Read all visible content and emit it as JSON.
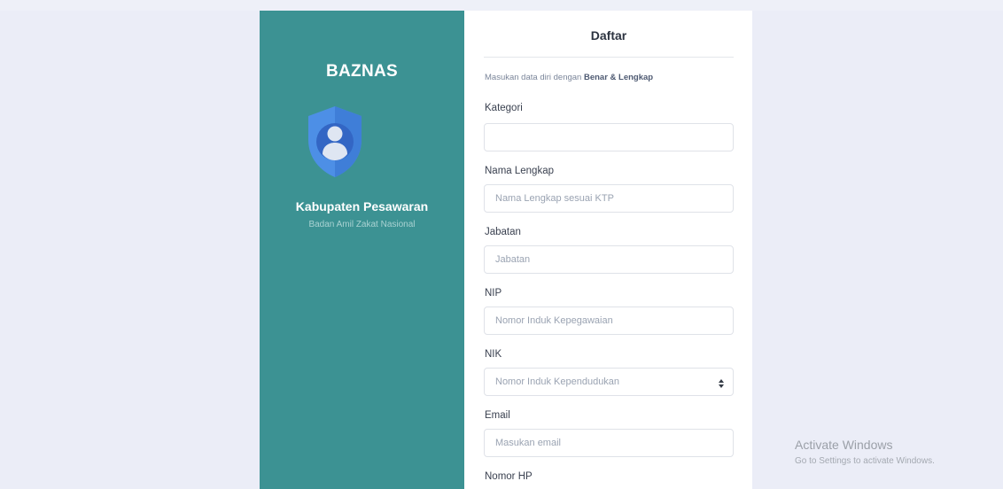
{
  "left_panel": {
    "brand": "BAZNAS",
    "region": "Kabupaten Pesawaran",
    "subtitle": "Badan Amil Zakat Nasional",
    "background_color": "#3c9293",
    "logo_icon": "user-shield-icon"
  },
  "form": {
    "title": "Daftar",
    "note_prefix": "Masukan data diri dengan ",
    "note_emphasis": "Benar & Lengkap",
    "fields": [
      {
        "label": "Kategori",
        "placeholder": ""
      },
      {
        "label": "Nama Lengkap",
        "placeholder": "Nama Lengkap sesuai KTP"
      },
      {
        "label": "Jabatan",
        "placeholder": "Jabatan"
      },
      {
        "label": "NIP",
        "placeholder": "Nomor Induk Kepegawaian"
      },
      {
        "label": "NIK",
        "placeholder": "Nomor Induk Kependudukan"
      },
      {
        "label": "Email",
        "placeholder": "Masukan email"
      },
      {
        "label": "Nomor HP"
      }
    ]
  },
  "watermark": {
    "title": "Activate Windows",
    "subtitle": "Go to Settings to activate Windows."
  }
}
